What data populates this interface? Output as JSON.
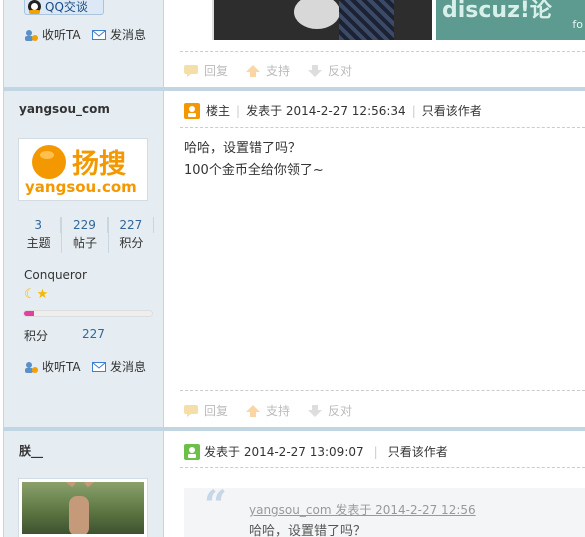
{
  "post_prev": {
    "qq_label": "QQ交谈",
    "follow_label": "收听TA",
    "message_label": "发消息",
    "image_text": "discuz!论",
    "image_text_small": "fo",
    "actions": {
      "reply": "回复",
      "support": "支持",
      "oppose": "反对"
    }
  },
  "post_op": {
    "username": "yangsou_com",
    "logo_text_cn": "扬搜",
    "logo_text_en_1": "yang",
    "logo_text_en_2": "sou",
    "logo_text_en_3": ".com",
    "stats": [
      {
        "value": "3",
        "label": "主题"
      },
      {
        "value": "229",
        "label": "帖子"
      },
      {
        "value": "227",
        "label": "积分"
      }
    ],
    "rank": "Conqueror",
    "points_label": "积分",
    "points_value": "227",
    "points_progress": 0.08,
    "follow_label": "收听TA",
    "message_label": "发消息",
    "badge": "楼主",
    "posted_at": "发表于 2014-2-27 12:56:34",
    "only_author": "只看该作者",
    "message_lines": [
      "哈哈，设置错了吗？",
      "100个金币全给你领了~"
    ],
    "actions": {
      "reply": "回复",
      "support": "支持",
      "oppose": "反对"
    }
  },
  "post_reply": {
    "username": "朕__",
    "posted_at": "发表于 2014-2-27 13:09:07",
    "only_author": "只看该作者",
    "quote_header": "yangsou_com 发表于 2014-2-27 12:56",
    "quote_text": "哈哈，设置错了吗？"
  },
  "colors": {
    "sidebar": "#e5edf2",
    "separator": "#c2d5e3",
    "accent_orange": "#f39800",
    "link_blue": "#336699",
    "progress": "#e040a0"
  }
}
